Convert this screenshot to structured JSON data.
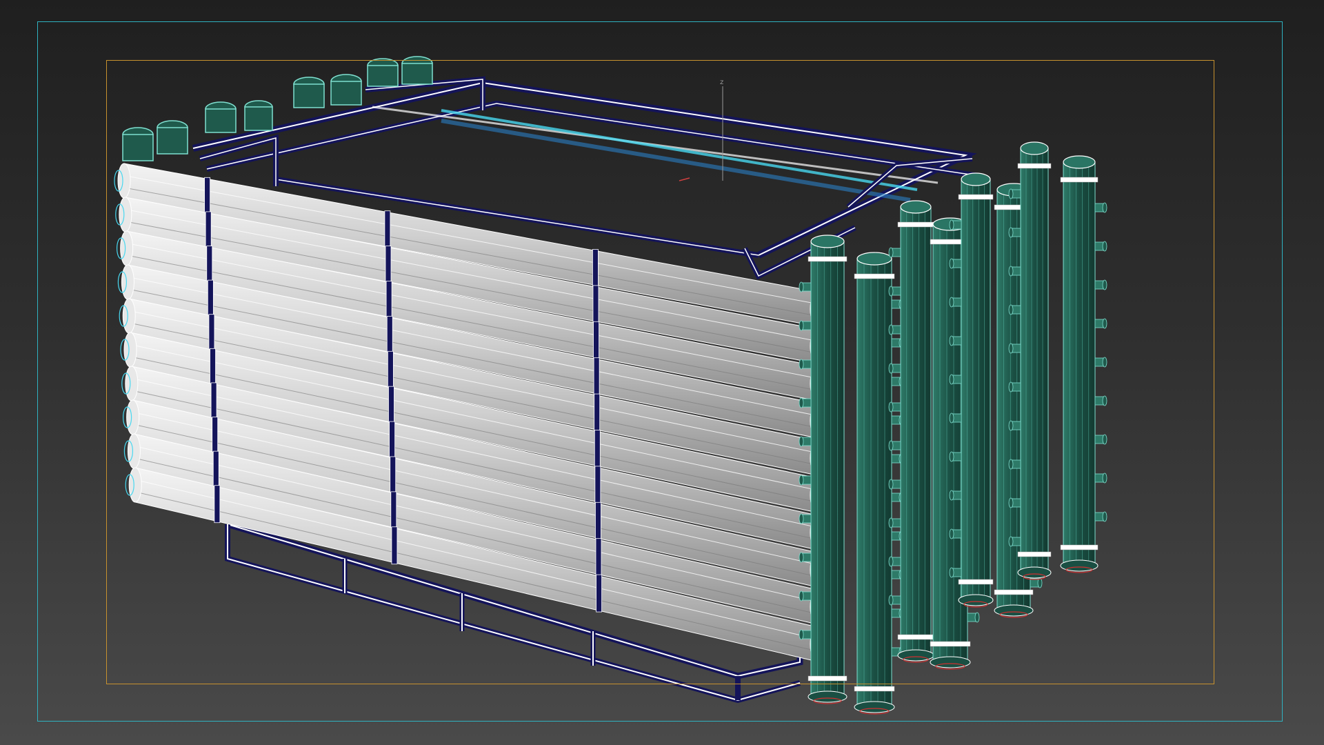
{
  "viewport": {
    "gizmo": {
      "z_label": "z"
    }
  },
  "colors": {
    "background_top": "#1f1f1f",
    "background_bottom": "#4a4a4a",
    "safe_frame": "#2fb3c2",
    "render_frame": "#c8922e",
    "pipe": "#d6d6d6",
    "frame_steel": "#14145a",
    "vessel": "#1f5a4c",
    "selection": "#48d8f0"
  }
}
